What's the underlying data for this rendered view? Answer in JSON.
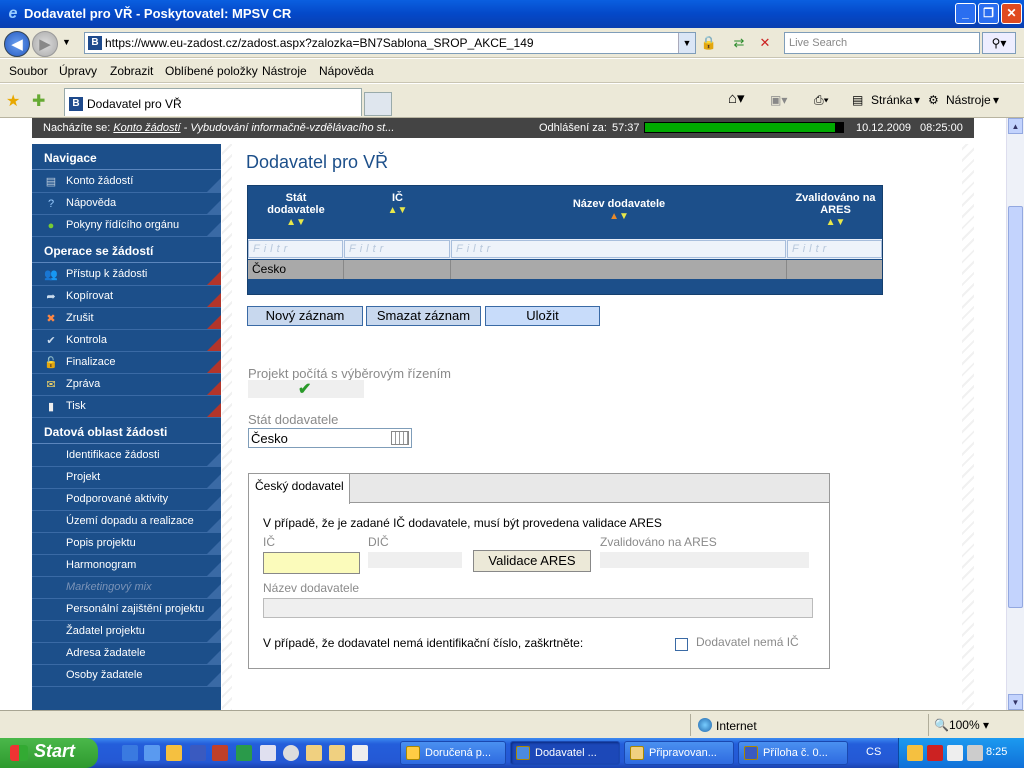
{
  "window": {
    "title": "Dodavatel pro VŘ - Poskytovatel: MPSV CR",
    "minimize": "_",
    "maximize": "❐",
    "close": "✕"
  },
  "browser": {
    "url": "https://www.eu-zadost.cz/zadost.aspx?zalozka=BN7Sablona_SROP_AKCE_149",
    "search_placeholder": "Live Search",
    "menu": [
      "Soubor",
      "Úpravy",
      "Zobrazit",
      "Oblíbené položky",
      "Nástroje",
      "Nápověda"
    ],
    "tab_title": "Dodavatel pro VŘ",
    "cmd_page": "Stránka",
    "cmd_tools": "Nástroje"
  },
  "header": {
    "location_label": "Nacházíte se:",
    "location_link": "Konto žádostí",
    "location_rest": " - Vybudování informačně-vzdělávacího st...",
    "logout_label": "Odhlášení za:",
    "logout_time": "57:37",
    "session_remaining_fraction": 0.96,
    "date": "10.12.2009",
    "time": "08:25:00"
  },
  "sidebar": {
    "sections": [
      {
        "title": "Navigace",
        "items": [
          {
            "label": "Konto žádostí",
            "icon": "list-icon",
            "corner": "blue"
          },
          {
            "label": "Nápověda",
            "icon": "help-icon",
            "corner": "blue"
          },
          {
            "label": "Pokyny řídícího orgánu",
            "icon": "info-icon",
            "corner": "blue"
          }
        ]
      },
      {
        "title": "Operace se žádostí",
        "items": [
          {
            "label": "Přístup k žádosti",
            "icon": "users-icon",
            "corner": "red"
          },
          {
            "label": "Kopírovat",
            "icon": "arrow-icon",
            "corner": "red"
          },
          {
            "label": "Zrušit",
            "icon": "cross-icon",
            "corner": "red"
          },
          {
            "label": "Kontrola",
            "icon": "check-icon",
            "corner": "red"
          },
          {
            "label": "Finalizace",
            "icon": "lock-icon",
            "corner": "red"
          },
          {
            "label": "Zpráva",
            "icon": "mail-icon",
            "corner": "red"
          },
          {
            "label": "Tisk",
            "icon": "print-icon",
            "corner": "red"
          }
        ]
      },
      {
        "title": "Datová oblast žádosti",
        "items": [
          {
            "label": "Identifikace žádosti"
          },
          {
            "label": "Projekt"
          },
          {
            "label": "Podporované aktivity"
          },
          {
            "label": "Území dopadu a realizace"
          },
          {
            "label": "Popis projektu"
          },
          {
            "label": "Harmonogram"
          },
          {
            "label": "Marketingový mix",
            "disabled": true
          },
          {
            "label": "Personální zajištění projektu"
          },
          {
            "label": "Žadatel projektu"
          },
          {
            "label": "Adresa žadatele"
          },
          {
            "label": "Osoby žadatele"
          }
        ]
      }
    ]
  },
  "page": {
    "title": "Dodavatel pro VŘ",
    "grid": {
      "columns": [
        {
          "label": "Stát dodavatele",
          "line1": "Stát",
          "line2": "dodavatele"
        },
        {
          "label": "IČ"
        },
        {
          "label": "Název dodavatele",
          "sorted": true
        },
        {
          "label": "Zvalidováno na ARES",
          "line1": "Zvalidováno na",
          "line2": "ARES"
        }
      ],
      "filter_placeholder": "Filtr",
      "rows": [
        [
          "Česko",
          "",
          "",
          ""
        ]
      ]
    },
    "buttons": {
      "new": "Nový záznam",
      "delete": "Smazat záznam",
      "save": "Uložit"
    },
    "project_tender_label": "Projekt počítá s výběrovým řízením",
    "project_tender_checked": true,
    "country_label": "Stát dodavatele",
    "country_value": "Česko",
    "tab_label": "Český dodavatel",
    "validation_note": "V případě, že je zadané IČ dodavatele, musí být provedena validace ARES",
    "ico_label": "IČ",
    "dic_label": "DIČ",
    "ares_button": "Validace ARES",
    "ares_label": "Zvalidováno na ARES",
    "name_label": "Název dodavatele",
    "no_ic_note": "V případě, že dodavatel nemá identifikační číslo, zaškrtněte:",
    "no_ic_label": "Dodavatel nemá IČ"
  },
  "statusbar": {
    "zone": "Internet",
    "zoom": "100%"
  },
  "taskbar": {
    "start": "Start",
    "tasks": [
      "Doručená p...",
      "Dodavatel ...",
      "Připravovan...",
      "Příloha č. 0..."
    ],
    "lang": "CS",
    "clock": "8:25"
  }
}
